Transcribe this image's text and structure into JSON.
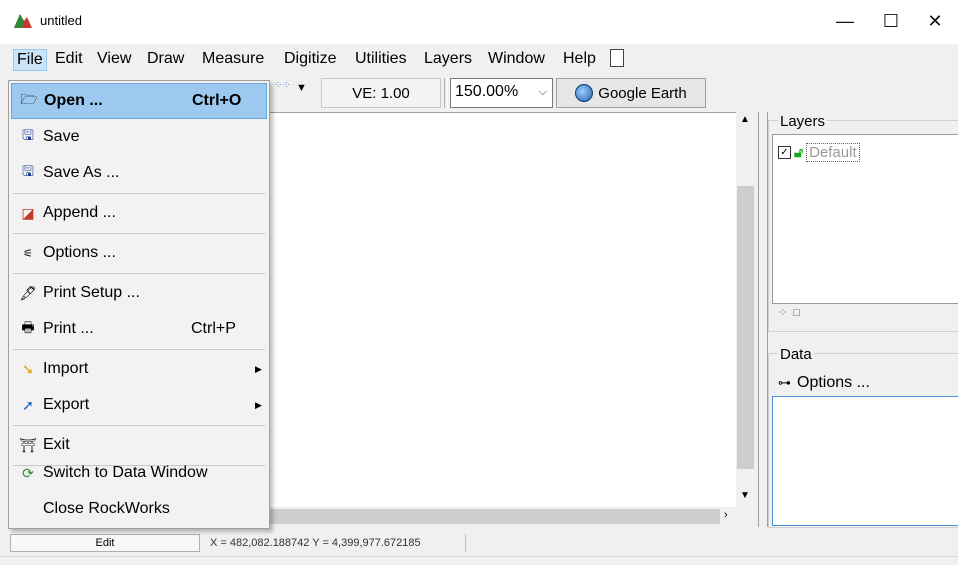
{
  "window": {
    "title": "untitled",
    "minimize": "—",
    "maximize": "☐",
    "close": "✕"
  },
  "menubar": {
    "items": [
      "File",
      "Edit",
      "View",
      "Draw",
      "Measure",
      "Digitize",
      "Utilities",
      "Layers",
      "Window",
      "Help"
    ]
  },
  "toolbar": {
    "ve_label": "VE: 1.00",
    "zoom_value": "150.00%",
    "google_earth_label": "Google Earth"
  },
  "file_menu": {
    "items": [
      {
        "label": "Open ...",
        "shortcut": "Ctrl+O",
        "icon": "folder-open-icon"
      },
      {
        "label": "Save",
        "icon": "floppy-icon"
      },
      {
        "label": "Save As ...",
        "icon": "floppy-as-icon"
      },
      {
        "label": "Append ...",
        "icon": "append-icon"
      },
      {
        "label": "Options ...",
        "icon": "options-icon"
      },
      {
        "label": "Print Setup ...",
        "icon": "print-setup-icon"
      },
      {
        "label": "Print ...",
        "shortcut": "Ctrl+P",
        "icon": "printer-icon"
      },
      {
        "label": "Import",
        "icon": "import-icon",
        "submenu": true
      },
      {
        "label": "Export",
        "icon": "export-icon",
        "submenu": true
      },
      {
        "label": "Exit",
        "icon": "exit-icon"
      },
      {
        "label": "Switch to Data Window",
        "icon": "switch-icon"
      },
      {
        "label": "Close RockWorks",
        "icon": ""
      }
    ]
  },
  "layers_panel": {
    "title": "Layers",
    "layer_name": "Default",
    "checked": true
  },
  "data_panel": {
    "title": "Data",
    "options_label": "Options ..."
  },
  "statusbar": {
    "mode": "Edit",
    "coords": "X = 482,082.188742  Y = 4,399,977.672185"
  },
  "colors": {
    "menu_highlight": "#9dc8ef",
    "active_menu": "#cce4f7",
    "data_box_border": "#4a90d9"
  }
}
